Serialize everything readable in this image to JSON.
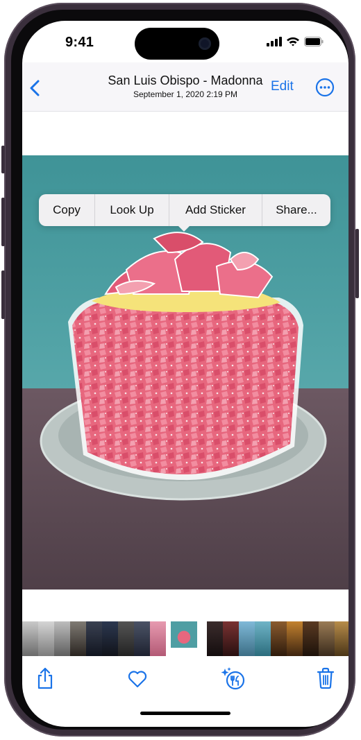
{
  "status_bar": {
    "time": "9:41",
    "icons": [
      "signal-icon",
      "wifi-icon",
      "battery-icon"
    ]
  },
  "nav": {
    "back_icon": "chevron-left-icon",
    "title": "San Luis Obispo - Madonna",
    "subtitle": "September 1, 2020  2:19 PM",
    "edit_label": "Edit",
    "more_icon": "ellipsis-circle-icon"
  },
  "context_menu": {
    "items": [
      "Copy",
      "Look Up",
      "Add Sticker",
      "Share..."
    ]
  },
  "photo": {
    "subject": "cake-subject-lift",
    "background_color": "#4f9ea3",
    "table_color": "#5d4a55"
  },
  "toolbar": {
    "icons": [
      "share-icon",
      "heart-icon",
      "visual-lookup-icon",
      "trash-icon"
    ]
  },
  "colors": {
    "accent": "#1a73e8",
    "frame": "#3a2f3c"
  }
}
